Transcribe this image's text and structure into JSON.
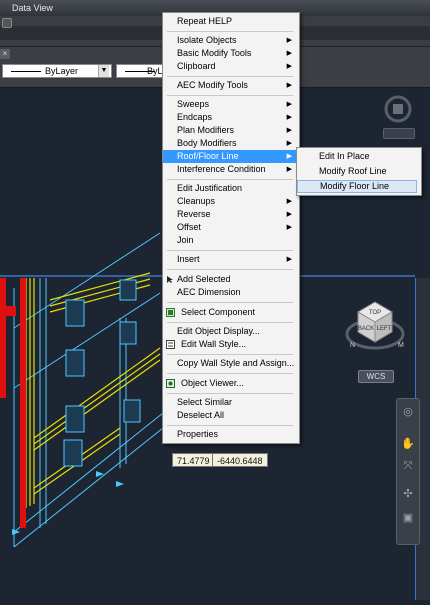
{
  "window": {
    "title": "Data View"
  },
  "propertybar": {
    "tab_close": "×",
    "layer_combo1": "ByLayer",
    "layer_combo2": "ByLay"
  },
  "context_menu": {
    "items": [
      {
        "label": "Repeat HELP"
      },
      {
        "label": "Isolate Objects",
        "submenu": true
      },
      {
        "label": "Basic Modify Tools",
        "submenu": true
      },
      {
        "label": "Clipboard",
        "submenu": true
      },
      {
        "label": "AEC Modify Tools",
        "submenu": true
      },
      {
        "label": "Sweeps",
        "submenu": true
      },
      {
        "label": "Endcaps",
        "submenu": true
      },
      {
        "label": "Plan Modifiers",
        "submenu": true
      },
      {
        "label": "Body Modifiers",
        "submenu": true
      },
      {
        "label": "Roof/Floor Line",
        "submenu": true,
        "highlighted": true
      },
      {
        "label": "Interference Condition",
        "submenu": true
      },
      {
        "label": "Edit Justification"
      },
      {
        "label": "Cleanups",
        "submenu": true
      },
      {
        "label": "Reverse",
        "submenu": true
      },
      {
        "label": "Offset",
        "submenu": true
      },
      {
        "label": "Join"
      },
      {
        "label": "Insert",
        "submenu": true
      },
      {
        "label": "Add Selected"
      },
      {
        "label": "AEC Dimension"
      },
      {
        "label": "Select Component"
      },
      {
        "label": "Edit Object Display..."
      },
      {
        "label": "Edit Wall Style..."
      },
      {
        "label": "Copy Wall Style and Assign..."
      },
      {
        "label": "Object Viewer..."
      },
      {
        "label": "Select Similar"
      },
      {
        "label": "Deselect All"
      },
      {
        "label": "Properties"
      }
    ]
  },
  "submenu": {
    "items": [
      {
        "label": "Edit In Place"
      },
      {
        "label": "Modify Roof Line"
      },
      {
        "label": "Modify Floor Line"
      }
    ]
  },
  "viewport": {
    "coord_x": "71.4779",
    "coord_y": "-6440.6448",
    "wcs": "WCS",
    "viewcube": {
      "left": "BACK",
      "right": "LEFT",
      "top": "TOP"
    },
    "compass": {
      "n": "N",
      "w": "W",
      "m": "M"
    }
  },
  "colors": {
    "menu_highlight": "#3399ff",
    "wall_yellow": "#e8e000",
    "structure_red": "#e01010",
    "grid_cyan": "#4ac8ff"
  }
}
